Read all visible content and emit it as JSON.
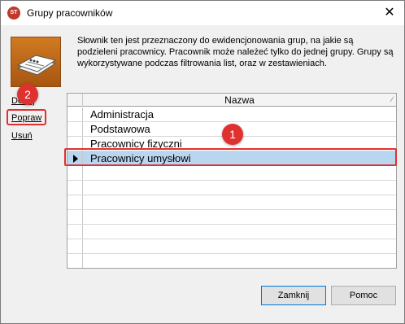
{
  "window": {
    "title": "Grupy pracowników",
    "app_icon": "app-logo-icon",
    "close_label": "✕"
  },
  "description": "Słownik ten jest przeznaczony do ewidencjonowania grup, na jakie są podzieleni pracownicy. Pracownik może należeć tylko do jednej grupy. Grupy są wykorzystywane podczas filtrowania list, oraz w zestawieniach.",
  "side_links": {
    "add": "Dodaj",
    "edit": "Popraw",
    "delete": "Usuń"
  },
  "grid": {
    "column_header": "Nazwa",
    "rows": [
      "Administracja",
      "Podstawowa",
      "Pracownicy fizyczni",
      "Pracownicy umysłowi"
    ],
    "selected_index": 3
  },
  "badges": {
    "first": "1",
    "second": "2"
  },
  "buttons": {
    "close": "Zamknij",
    "help": "Pomoc"
  },
  "colors": {
    "highlight": "#e03131",
    "selection": "#b8d6f0",
    "icon_orange": "#d07a22"
  }
}
